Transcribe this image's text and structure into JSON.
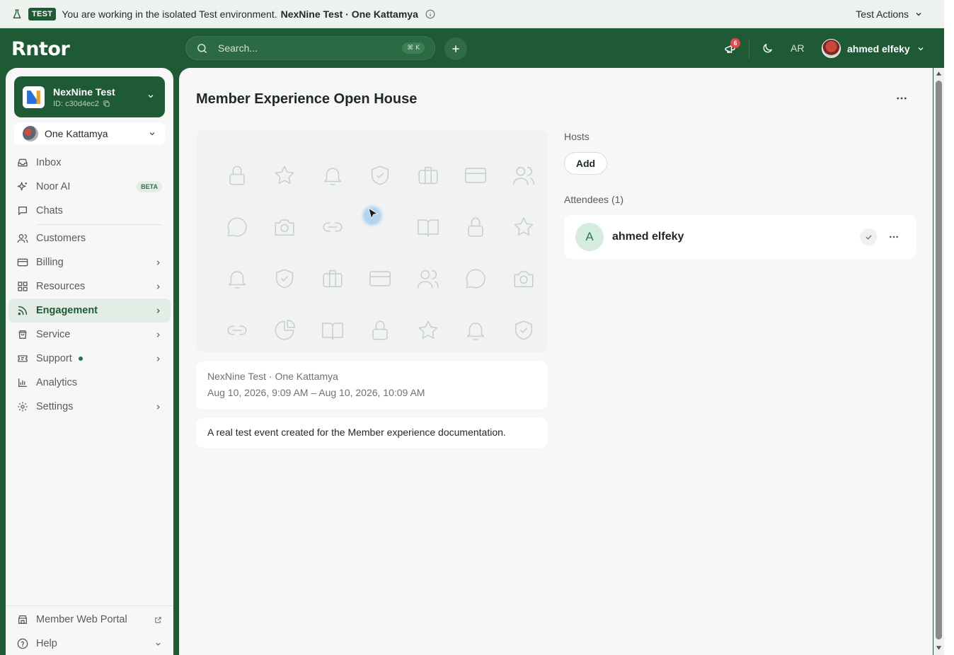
{
  "banner": {
    "badge": "TEST",
    "text": "You are working in the isolated Test environment.",
    "strong": "NexNine Test · One Kattamya",
    "actions_label": "Test Actions"
  },
  "topbar": {
    "logo": "Rntor",
    "search_placeholder": "Search...",
    "search_shortcut": "⌘ K",
    "notifications_count": "6",
    "language": "AR",
    "user_name": "ahmed elfeky"
  },
  "sidebar": {
    "org_name": "NexNine Test",
    "org_id": "ID: c30d4ec2",
    "location": "One Kattamya",
    "items": [
      {
        "label": "Inbox",
        "icon": "inbox-icon"
      },
      {
        "label": "Noor AI",
        "icon": "sparkle-icon",
        "badge": "BETA"
      },
      {
        "label": "Chats",
        "icon": "chat-icon"
      },
      {
        "label": "Customers",
        "icon": "users-icon"
      },
      {
        "label": "Billing",
        "icon": "card-icon"
      },
      {
        "label": "Resources",
        "icon": "grid-icon"
      },
      {
        "label": "Engagement",
        "icon": "rss-icon",
        "active": true
      },
      {
        "label": "Service",
        "icon": "bag-icon"
      },
      {
        "label": "Support",
        "icon": "ticket-icon"
      },
      {
        "label": "Analytics",
        "icon": "bar-chart-icon"
      },
      {
        "label": "Settings",
        "icon": "gear-icon"
      }
    ],
    "footer": [
      {
        "label": "Member Web Portal",
        "icon": "store-icon"
      },
      {
        "label": "Help",
        "icon": "help-icon"
      }
    ]
  },
  "event": {
    "title": "Member Experience Open House",
    "venue": "NexNine Test · One Kattamya",
    "datetime": "Aug 10, 2026, 9:09 AM – Aug 10, 2026, 10:09 AM",
    "description": "A real test event created for the Member experience documentation.",
    "hosts_label": "Hosts",
    "add_label": "Add",
    "attendees_label": "Attendees (1)",
    "attendees": [
      {
        "initial": "A",
        "name": "ahmed elfeky"
      }
    ]
  }
}
